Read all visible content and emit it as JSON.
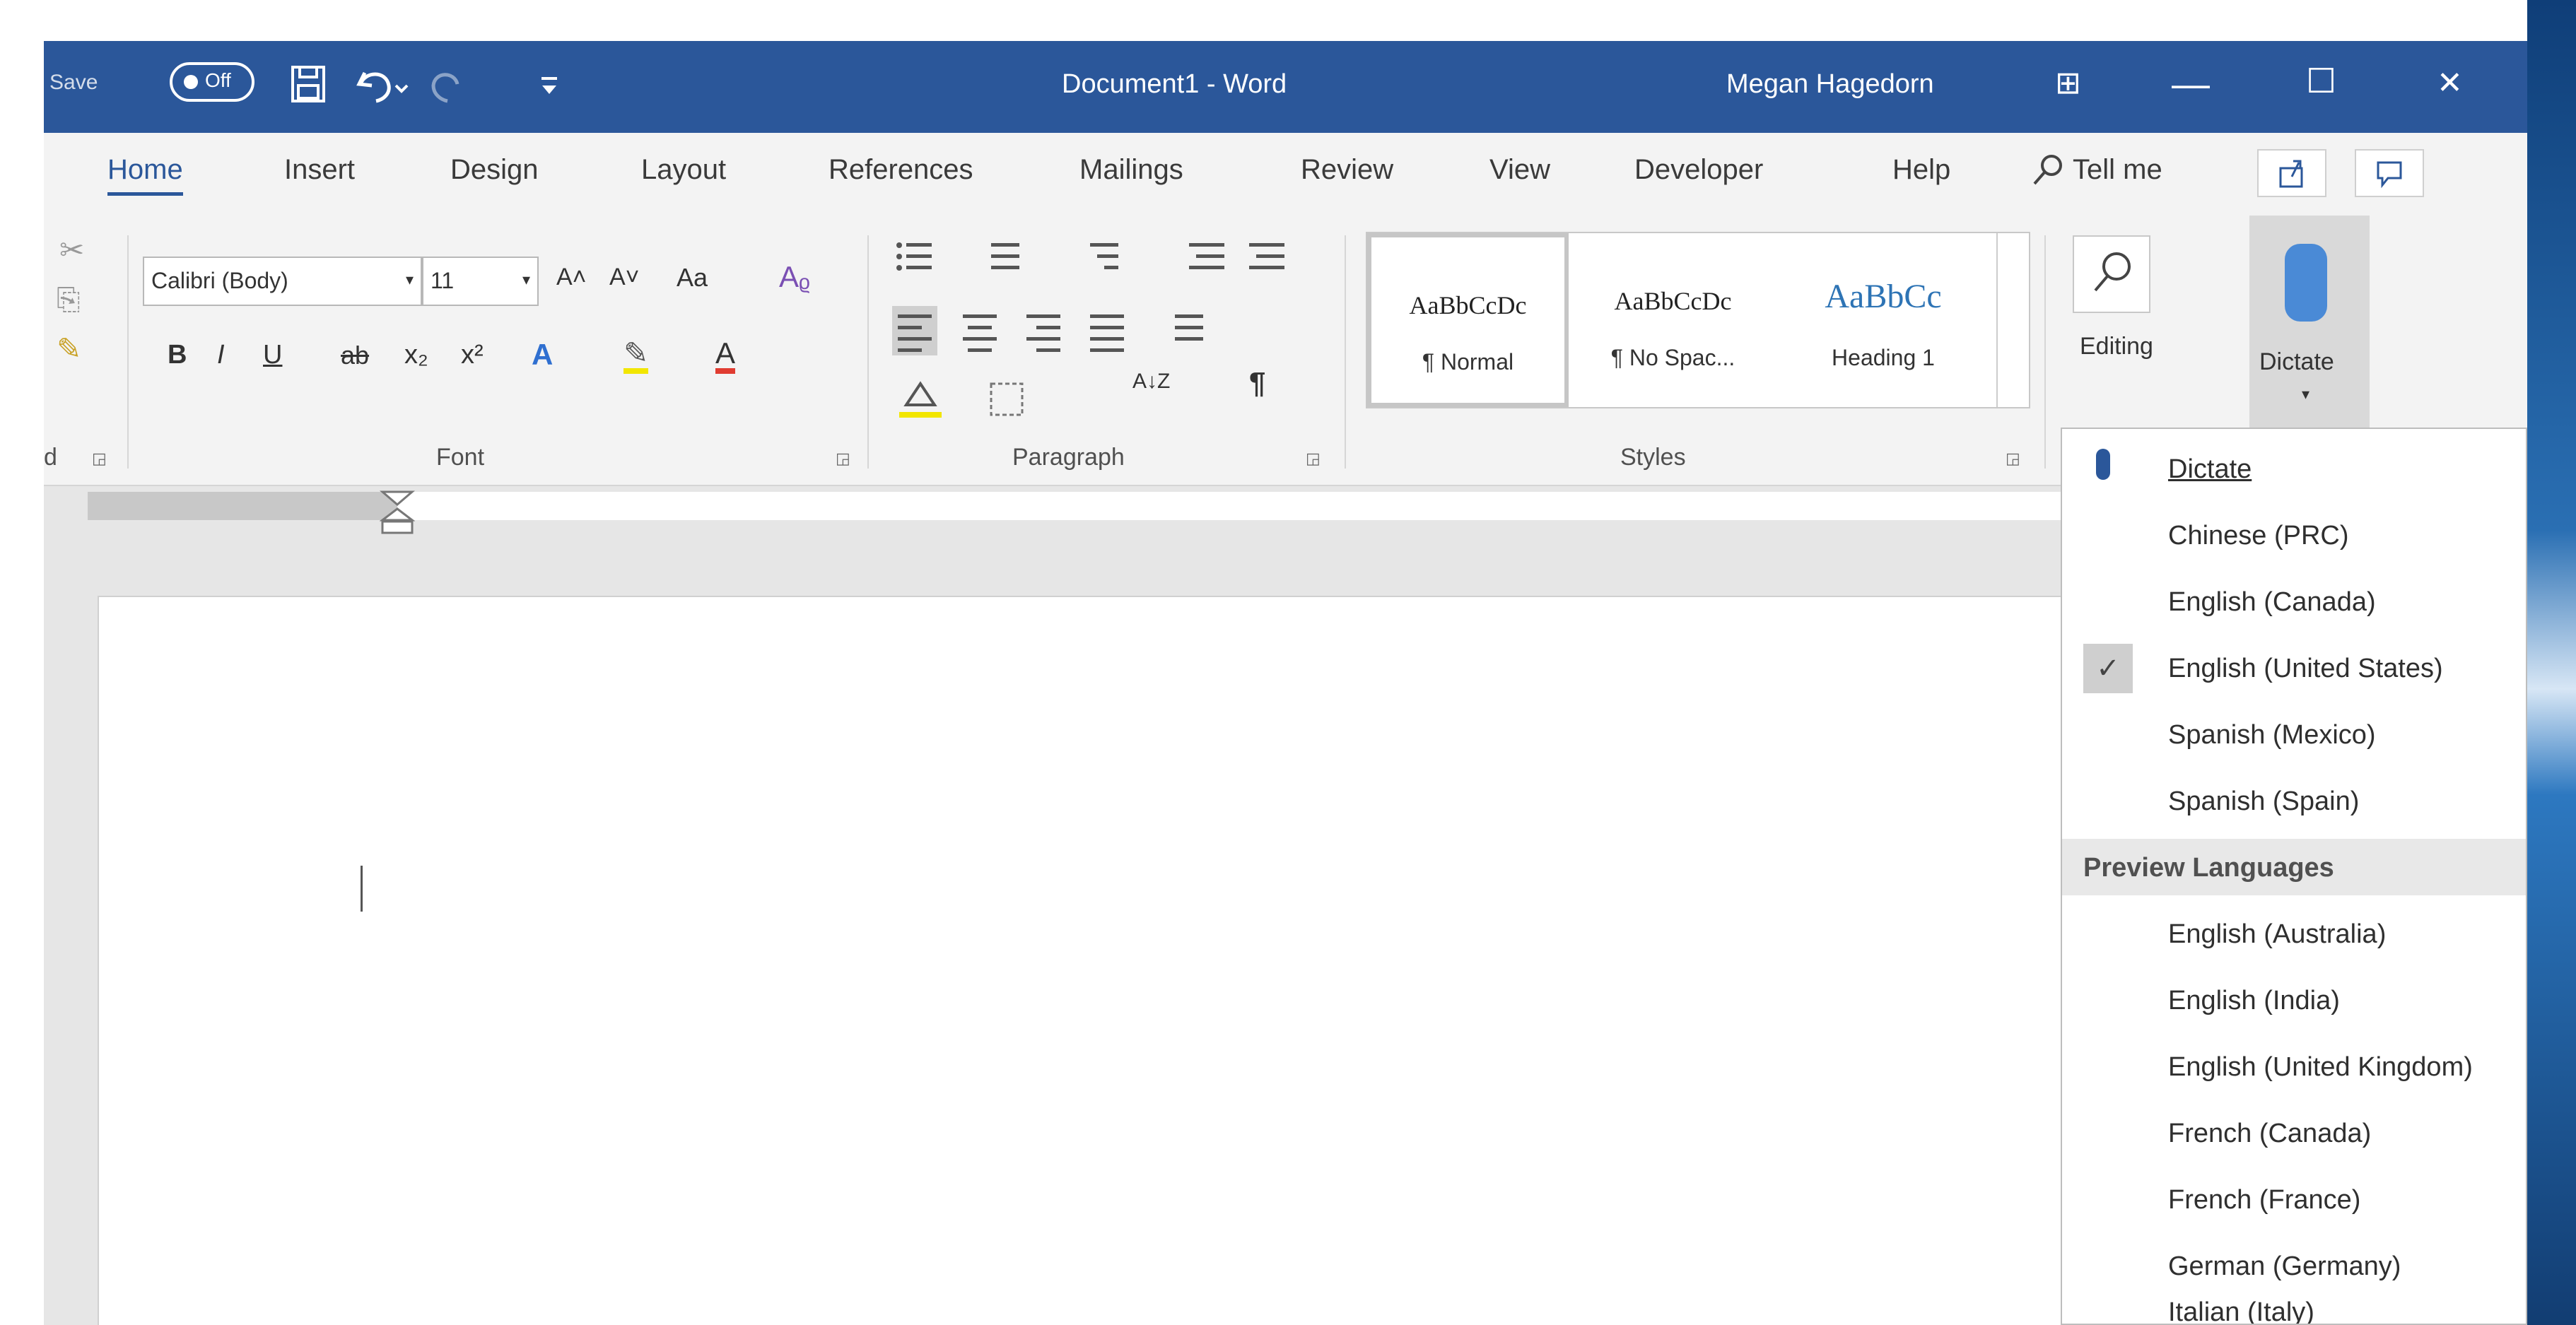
{
  "titlebar": {
    "autosave_label": "Save",
    "autosave_state": "Off",
    "document_title": "Document1 - Word",
    "user_name": "Megan Hagedorn",
    "save_icon": "save-icon",
    "undo_icon": "undo-icon",
    "redo_icon": "redo-icon",
    "customize_icon": "customize-quick-access-icon",
    "minimize_symbol": "—",
    "maximize_symbol": "☐",
    "close_symbol": "✕",
    "ribbon_display_symbol": "⊞"
  },
  "tabs": [
    "Home",
    "Insert",
    "Design",
    "Layout",
    "References",
    "Mailings",
    "Review",
    "View",
    "Developer",
    "Help"
  ],
  "active_tab": "Home",
  "tell_me": "Tell me",
  "share_icon": "share-icon",
  "comments_icon": "comments-icon",
  "ribbon": {
    "clipboard_label_partial": "d",
    "font": {
      "name": "Calibri (Body)",
      "size": "11",
      "grow": "A˄",
      "shrink": "A˅",
      "change_case": "Aa",
      "bold": "B",
      "italic": "I",
      "underline": "U",
      "strike": "ab",
      "subscript": "x₂",
      "superscript": "x²",
      "text_effects": "A",
      "highlight": "✎",
      "font_color": "A",
      "label": "Font"
    },
    "paragraph": {
      "label": "Paragraph",
      "pilcrow": "¶",
      "sort": "A↓Z"
    },
    "styles": {
      "label": "Styles",
      "items": [
        {
          "sample": "AaBbCcDc",
          "name": "¶ Normal"
        },
        {
          "sample": "AaBbCcDc",
          "name": "¶ No Spac..."
        },
        {
          "sample": "AaBbCc",
          "name": "Heading 1"
        }
      ]
    },
    "editing_label": "Editing",
    "dictate_label": "Dictate"
  },
  "dictate_menu": {
    "dictate_item": "Dictate",
    "languages": [
      {
        "label": "Chinese (PRC)",
        "checked": false
      },
      {
        "label": "English (Canada)",
        "checked": false
      },
      {
        "label": "English (United States)",
        "checked": true
      },
      {
        "label": "Spanish (Mexico)",
        "checked": false
      },
      {
        "label": "Spanish (Spain)",
        "checked": false
      }
    ],
    "preview_header": "Preview Languages",
    "preview_languages": [
      "English (Australia)",
      "English (India)",
      "English (United Kingdom)",
      "French (Canada)",
      "French (France)",
      "German (Germany)",
      "Italian (Italy)"
    ]
  },
  "colors": {
    "word_blue": "#2b579a",
    "ribbon_bg": "#f3f3f3",
    "workspace_bg": "#e6e6e6"
  }
}
